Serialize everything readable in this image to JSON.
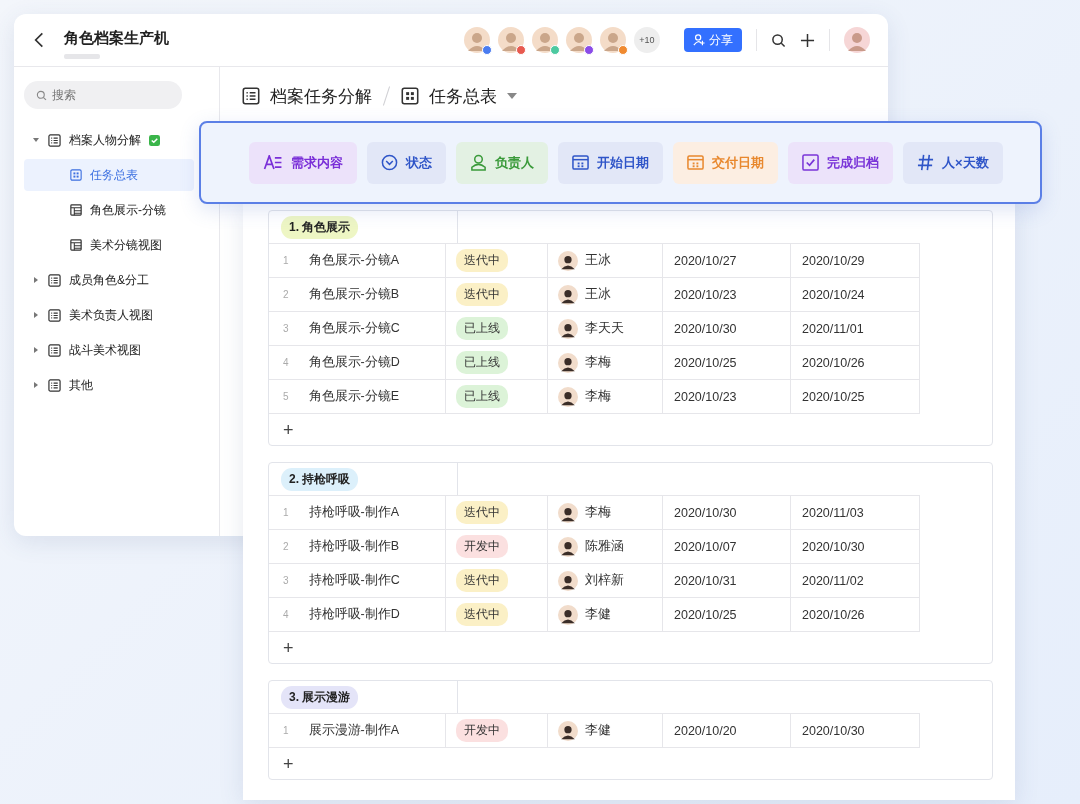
{
  "window": {
    "title": "角色档案生产机"
  },
  "collaborators": [
    {
      "color": "#4a7cf0"
    },
    {
      "color": "#e85a4f"
    },
    {
      "color": "#4cc9a0"
    },
    {
      "color": "#8a4ce8"
    },
    {
      "color": "#f08a30"
    }
  ],
  "more_count": "+10",
  "share_button": "分享",
  "search": {
    "placeholder": "搜索"
  },
  "sidebar": {
    "items": [
      {
        "label": "档案人物分解",
        "kind": "doc",
        "expanded": true,
        "verified": true,
        "selected": false,
        "children": [
          {
            "label": "任务总表",
            "kind": "grid",
            "selected": true
          },
          {
            "label": "角色展示-分镜",
            "kind": "table",
            "selected": false
          },
          {
            "label": "美术分镜视图",
            "kind": "table",
            "selected": false
          }
        ]
      },
      {
        "label": "成员角色&分工",
        "kind": "doc",
        "expanded": false,
        "verified": false,
        "selected": false
      },
      {
        "label": "美术负责人视图",
        "kind": "doc",
        "expanded": false,
        "verified": false,
        "selected": false
      },
      {
        "label": "战斗美术视图",
        "kind": "doc",
        "expanded": false,
        "verified": false,
        "selected": false
      },
      {
        "label": "其他",
        "kind": "doc",
        "expanded": false,
        "verified": false,
        "selected": false
      }
    ]
  },
  "breadcrumb": [
    {
      "label": "档案任务分解",
      "kind": "doc"
    },
    {
      "label": "任务总表",
      "kind": "grid"
    }
  ],
  "field_types": [
    {
      "label": "需求内容",
      "kind": "text",
      "color": "#7a2fd8"
    },
    {
      "label": "状态",
      "kind": "select",
      "color": "#2f55c8"
    },
    {
      "label": "负责人",
      "kind": "person",
      "color": "#3a9a3a"
    },
    {
      "label": "开始日期",
      "kind": "date",
      "color": "#2f55c8"
    },
    {
      "label": "交付日期",
      "kind": "date",
      "color": "#e8882e"
    },
    {
      "label": "完成归档",
      "kind": "checkbox",
      "color": "#7a35d8"
    },
    {
      "label": "人×天数",
      "kind": "number",
      "color": "#2f55c8"
    }
  ],
  "groups": [
    {
      "title": "1. 角色展示",
      "color": "#eef6c4",
      "add_button": "+",
      "rows": [
        {
          "index": "1",
          "name": "角色展示-分镜A",
          "status": {
            "text": "迭代中",
            "color": "#fbf0c6"
          },
          "assignee": "王冰",
          "start": "2020/10/27",
          "end": "2020/10/29"
        },
        {
          "index": "2",
          "name": "角色展示-分镜B",
          "status": {
            "text": "迭代中",
            "color": "#fbf0c6"
          },
          "assignee": "王冰",
          "start": "2020/10/23",
          "end": "2020/10/24"
        },
        {
          "index": "3",
          "name": "角色展示-分镜C",
          "status": {
            "text": "已上线",
            "color": "#dcf3d8"
          },
          "assignee": "李天天",
          "start": "2020/10/30",
          "end": "2020/11/01"
        },
        {
          "index": "4",
          "name": "角色展示-分镜D",
          "status": {
            "text": "已上线",
            "color": "#dcf3d8"
          },
          "assignee": "李梅",
          "start": "2020/10/25",
          "end": "2020/10/26"
        },
        {
          "index": "5",
          "name": "角色展示-分镜E",
          "status": {
            "text": "已上线",
            "color": "#dcf3d8"
          },
          "assignee": "李梅",
          "start": "2020/10/23",
          "end": "2020/10/25"
        }
      ]
    },
    {
      "title": "2. 持枪呼吸",
      "color": "#dcf0fb",
      "add_button": "+",
      "rows": [
        {
          "index": "1",
          "name": "持枪呼吸-制作A",
          "status": {
            "text": "迭代中",
            "color": "#fbf0c6"
          },
          "assignee": "李梅",
          "start": "2020/10/30",
          "end": "2020/11/03"
        },
        {
          "index": "2",
          "name": "持枪呼吸-制作B",
          "status": {
            "text": "开发中",
            "color": "#fbe0e0"
          },
          "assignee": "陈雅涵",
          "start": "2020/10/07",
          "end": "2020/10/30"
        },
        {
          "index": "3",
          "name": "持枪呼吸-制作C",
          "status": {
            "text": "迭代中",
            "color": "#fbf0c6"
          },
          "assignee": "刘梓新",
          "start": "2020/10/31",
          "end": "2020/11/02"
        },
        {
          "index": "4",
          "name": "持枪呼吸-制作D",
          "status": {
            "text": "迭代中",
            "color": "#fbf0c6"
          },
          "assignee": "李健",
          "start": "2020/10/25",
          "end": "2020/10/26"
        }
      ]
    },
    {
      "title": "3. 展示漫游",
      "color": "#e4e4f8",
      "add_button": "+",
      "rows": [
        {
          "index": "1",
          "name": "展示漫游-制作A",
          "status": {
            "text": "开发中",
            "color": "#fbe0e0"
          },
          "assignee": "李健",
          "start": "2020/10/20",
          "end": "2020/10/30"
        }
      ]
    }
  ]
}
